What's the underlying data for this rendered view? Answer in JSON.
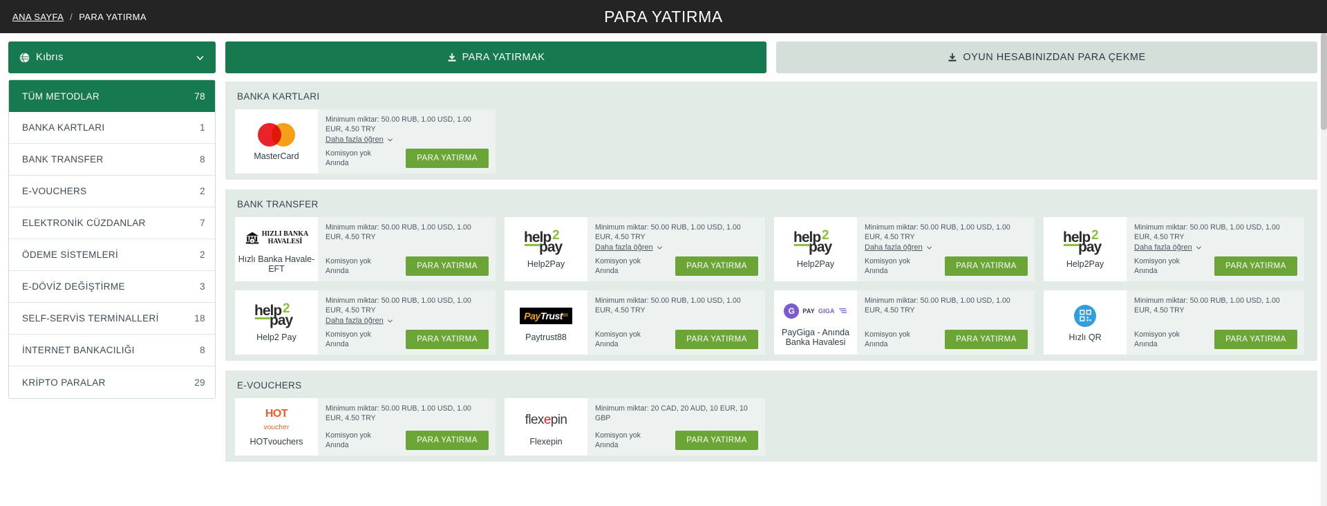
{
  "topbar": {
    "breadcrumb_home": "ANA SAYFA",
    "breadcrumb_sep": "/",
    "breadcrumb_current": "PARA YATIRMA",
    "title": "PARA YATIRMA"
  },
  "sidebar": {
    "region": {
      "label": "Kıbrıs",
      "icon": "globe-icon",
      "chevron": "chevron-down-icon"
    },
    "items": [
      {
        "label": "TÜM METODLAR",
        "count": "78",
        "active": true
      },
      {
        "label": "BANKA KARTLARI",
        "count": "1",
        "active": false
      },
      {
        "label": "BANK TRANSFER",
        "count": "8",
        "active": false
      },
      {
        "label": "E-VOUCHERS",
        "count": "2",
        "active": false
      },
      {
        "label": "ELEKTRONİK CÜZDANLAR",
        "count": "7",
        "active": false
      },
      {
        "label": "ÖDEME SİSTEMLERİ",
        "count": "2",
        "active": false
      },
      {
        "label": "E-DÖVİZ DEĞİŞTİRME",
        "count": "3",
        "active": false
      },
      {
        "label": "SELF-SERVİS TERMİNALLERİ",
        "count": "18",
        "active": false
      },
      {
        "label": "İNTERNET BANKACILIĞI",
        "count": "8",
        "active": false
      },
      {
        "label": "KRİPTO PARALAR",
        "count": "29",
        "active": false
      }
    ]
  },
  "tabs": [
    {
      "label": "PARA YATIRMAK",
      "icon": "download-icon",
      "active": true
    },
    {
      "label": "OYUN HESABINIZDAN PARA ÇEKME",
      "icon": "upload-icon",
      "active": false
    }
  ],
  "labels": {
    "more_info": "Daha fazla öğren",
    "no_commission": "Komisyon yok",
    "instant": "Anında",
    "deposit_button": "PARA YATIRMA"
  },
  "colors": {
    "brand_green": "#17794f",
    "button_green": "#6aa535",
    "topbar_dark": "#242424",
    "section_bg": "#e3ebe7"
  },
  "sections": [
    {
      "title": "BANKA KARTLARI",
      "cards": [
        {
          "name": "MasterCard",
          "logo": "mastercard-logo",
          "minimum": "Minimum miktar: 50.00 RUB, 1.00 USD, 1.00 EUR, 4.50 TRY",
          "has_more": true,
          "commission": "Komisyon yok",
          "speed": "Anında",
          "button": "PARA YATIRMA"
        }
      ]
    },
    {
      "title": "BANK TRANSFER",
      "cards": [
        {
          "name": "Hızlı Banka Havale-EFT",
          "logo": "hizli-banka-havalesi-logo",
          "minimum": "Minimum miktar: 50.00 RUB, 1.00 USD, 1.00 EUR, 4.50 TRY",
          "has_more": false,
          "commission": "Komisyon yok",
          "speed": "Anında",
          "button": "PARA YATIRMA"
        },
        {
          "name": "Help2Pay",
          "logo": "help2pay-logo",
          "minimum": "Minimum miktar: 50.00 RUB, 1.00 USD, 1.00 EUR, 4.50 TRY",
          "has_more": true,
          "commission": "Komisyon yok",
          "speed": "Anında",
          "button": "PARA YATIRMA"
        },
        {
          "name": "Help2Pay",
          "logo": "help2pay-logo",
          "minimum": "Minimum miktar: 50.00 RUB, 1.00 USD, 1.00 EUR, 4.50 TRY",
          "has_more": true,
          "commission": "Komisyon yok",
          "speed": "Anında",
          "button": "PARA YATIRMA"
        },
        {
          "name": "Help2Pay",
          "logo": "help2pay-logo",
          "minimum": "Minimum miktar: 50.00 RUB, 1.00 USD, 1.00 EUR, 4.50 TRY",
          "has_more": true,
          "commission": "Komisyon yok",
          "speed": "Anında",
          "button": "PARA YATIRMA"
        },
        {
          "name": "Help2 Pay",
          "logo": "help2pay-logo",
          "minimum": "Minimum miktar: 50.00 RUB, 1.00 USD, 1.00 EUR, 4.50 TRY",
          "has_more": true,
          "commission": "Komisyon yok",
          "speed": "Anında",
          "button": "PARA YATIRMA"
        },
        {
          "name": "Paytrust88",
          "logo": "paytrust88-logo",
          "minimum": "Minimum miktar: 50.00 RUB, 1.00 USD, 1.00 EUR, 4.50 TRY",
          "has_more": false,
          "commission": "Komisyon yok",
          "speed": "Anında",
          "button": "PARA YATIRMA"
        },
        {
          "name": "PayGiga - Anında Banka Havalesi",
          "logo": "paygiga-logo",
          "minimum": "Minimum miktar: 50.00 RUB, 1.00 USD, 1.00 EUR, 4.50 TRY",
          "has_more": false,
          "commission": "Komisyon yok",
          "speed": "Anında",
          "button": "PARA YATIRMA"
        },
        {
          "name": "Hızlı QR",
          "logo": "hizli-qr-logo",
          "minimum": "Minimum miktar: 50.00 RUB, 1.00 USD, 1.00 EUR, 4.50 TRY",
          "has_more": false,
          "commission": "Komisyon yok",
          "speed": "Anında",
          "button": "PARA YATIRMA"
        }
      ]
    },
    {
      "title": "E-VOUCHERS",
      "cards": [
        {
          "name": "HOTvouchers",
          "logo": "hotvoucher-logo",
          "minimum": "Minimum miktar: 50.00 RUB, 1.00 USD, 1.00 EUR, 4.50 TRY",
          "has_more": false,
          "commission": "Komisyon yok",
          "speed": "Anında",
          "button": "PARA YATIRMA"
        },
        {
          "name": "Flexepin",
          "logo": "flexepin-logo",
          "minimum": "Minimum miktar: 20 CAD, 20 AUD, 10 EUR, 10 GBP",
          "has_more": false,
          "commission": "Komisyon yok",
          "speed": "Anında",
          "button": "PARA YATIRMA"
        }
      ]
    }
  ]
}
